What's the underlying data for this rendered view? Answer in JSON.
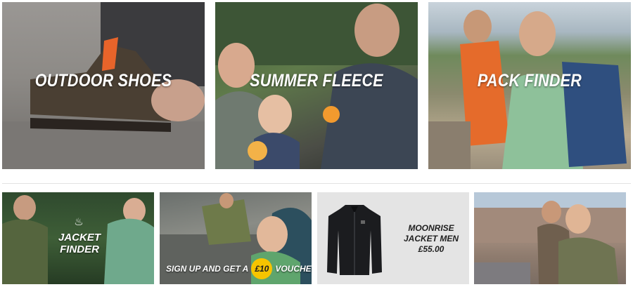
{
  "top_tiles": [
    {
      "label": "OUTDOOR SHOES"
    },
    {
      "label": "SUMMER FLEECE"
    },
    {
      "label": "PACK FINDER"
    }
  ],
  "bottom_tiles": {
    "jacket_finder": {
      "line1": "JACKET",
      "line2": "FINDER",
      "icon": "hanger-icon"
    },
    "voucher": {
      "before": "SIGN UP AND GET A",
      "badge": "£10",
      "after": "VOUCHER"
    },
    "product": {
      "line1": "MOONRISE",
      "line2": "JACKET MEN",
      "price": "£55.00"
    },
    "photo": {}
  },
  "colors": {
    "label_text": "#ffffff",
    "voucher_badge": "#f6c400",
    "product_bg": "#e4e4e4",
    "product_text": "#1f1f1f"
  }
}
